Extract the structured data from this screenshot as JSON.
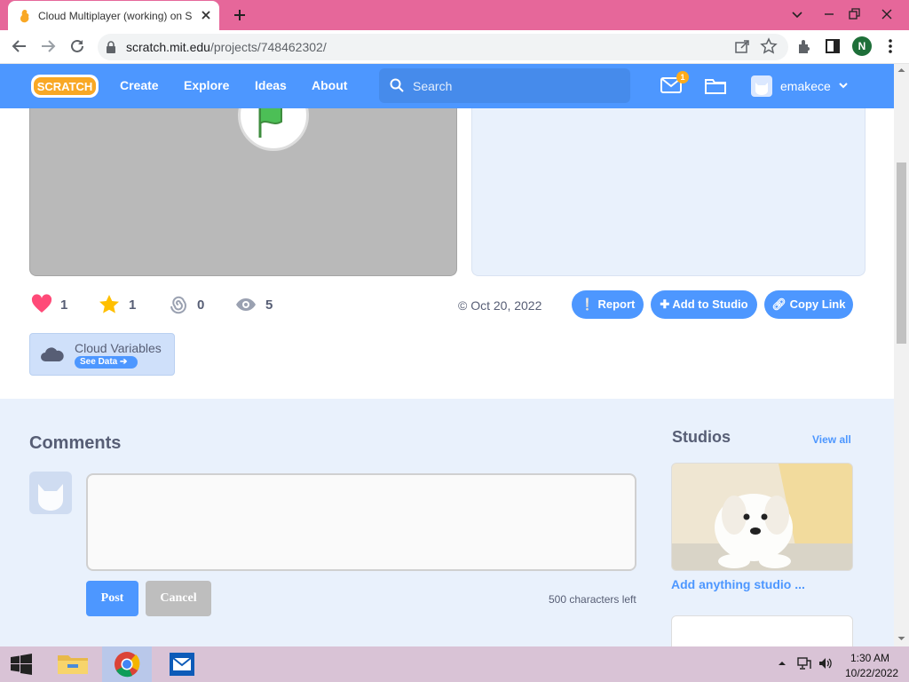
{
  "browser": {
    "tab_title": "Cloud Multiplayer (working) on S",
    "url_host": "scratch.mit.edu",
    "url_path": "/projects/748462302/",
    "profile_initial": "N",
    "titlebar_color": "#e6679a"
  },
  "scratch_nav": {
    "logo_text": "SCRATCH",
    "links": [
      "Create",
      "Explore",
      "Ideas",
      "About"
    ],
    "search_placeholder": "Search",
    "message_count": "1",
    "username": "emakece",
    "accent": "#4d97ff"
  },
  "project": {
    "stats": {
      "loves": "1",
      "favorites": "1",
      "remixes": "0",
      "views": "5"
    },
    "shared_date": "© Oct 20, 2022",
    "actions": {
      "report": "Report",
      "add_to_studio": "Add to Studio",
      "copy_link": "Copy Link"
    },
    "cloud_variables": {
      "title": "Cloud Variables",
      "see_data": "See Data"
    }
  },
  "comments": {
    "title": "Comments",
    "post_label": "Post",
    "cancel_label": "Cancel",
    "chars_left": "500 characters left"
  },
  "studios": {
    "title": "Studios",
    "view_all": "View all",
    "items": [
      {
        "title": "Add anything studio ..."
      }
    ]
  },
  "taskbar": {
    "time": "1:30 AM",
    "date": "10/22/2022"
  }
}
